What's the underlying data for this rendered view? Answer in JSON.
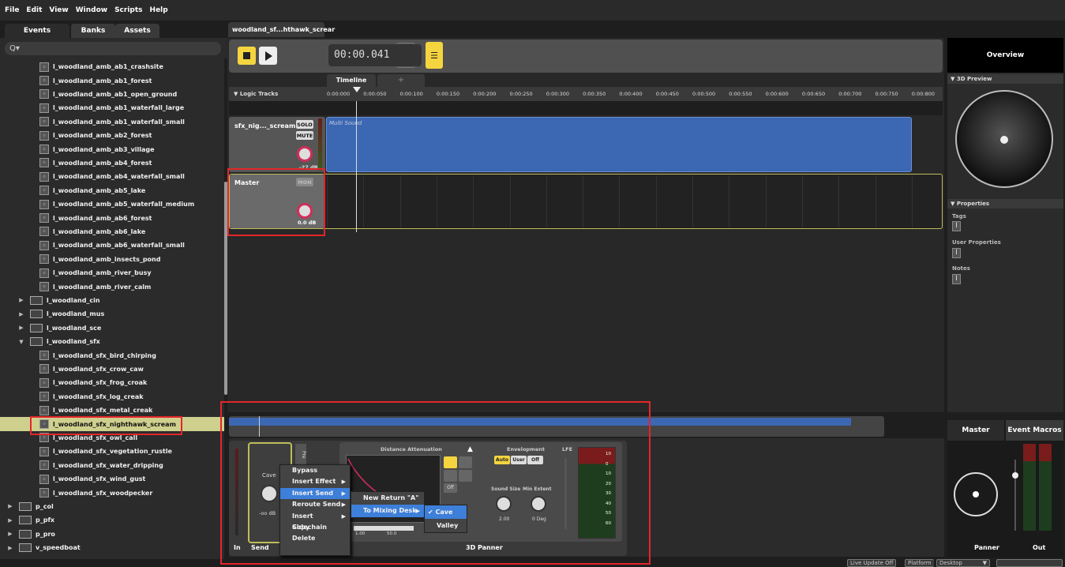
{
  "menu": [
    "File",
    "Edit",
    "View",
    "Window",
    "Scripts",
    "Help"
  ],
  "left_tabs": [
    "Events",
    "Banks",
    "Assets"
  ],
  "search": {
    "icon": "Q▾"
  },
  "browser_items": [
    {
      "type": "event",
      "label": "l_woodland_amb_ab1_crashsite",
      "indent": 1
    },
    {
      "type": "event",
      "label": "l_woodland_amb_ab1_forest",
      "indent": 1
    },
    {
      "type": "event",
      "label": "l_woodland_amb_ab1_open_ground",
      "indent": 1
    },
    {
      "type": "event",
      "label": "l_woodland_amb_ab1_waterfall_large",
      "indent": 1
    },
    {
      "type": "event",
      "label": "l_woodland_amb_ab1_waterfall_small",
      "indent": 1
    },
    {
      "type": "event",
      "label": "l_woodland_amb_ab2_forest",
      "indent": 1
    },
    {
      "type": "event",
      "label": "l_woodland_amb_ab3_village",
      "indent": 1
    },
    {
      "type": "event",
      "label": "l_woodland_amb_ab4_forest",
      "indent": 1
    },
    {
      "type": "event",
      "label": "l_woodland_amb_ab4_waterfall_small",
      "indent": 1
    },
    {
      "type": "event",
      "label": "l_woodland_amb_ab5_lake",
      "indent": 1
    },
    {
      "type": "event",
      "label": "l_woodland_amb_ab5_waterfall_medium",
      "indent": 1
    },
    {
      "type": "event",
      "label": "l_woodland_amb_ab6_forest",
      "indent": 1
    },
    {
      "type": "event",
      "label": "l_woodland_amb_ab6_lake",
      "indent": 1
    },
    {
      "type": "event",
      "label": "l_woodland_amb_ab6_waterfall_small",
      "indent": 1
    },
    {
      "type": "event",
      "label": "l_woodland_amb_insects_pond",
      "indent": 1
    },
    {
      "type": "event",
      "label": "l_woodland_amb_river_busy",
      "indent": 1
    },
    {
      "type": "event",
      "label": "l_woodland_amb_river_calm",
      "indent": 1
    },
    {
      "type": "folder",
      "label": "l_woodland_cin",
      "indent": 0,
      "open": false
    },
    {
      "type": "folder",
      "label": "l_woodland_mus",
      "indent": 0,
      "open": false
    },
    {
      "type": "folder",
      "label": "l_woodland_sce",
      "indent": 0,
      "open": false
    },
    {
      "type": "folder",
      "label": "l_woodland_sfx",
      "indent": 0,
      "open": true
    },
    {
      "type": "event",
      "label": "l_woodland_sfx_bird_chirping",
      "indent": 1
    },
    {
      "type": "event",
      "label": "l_woodland_sfx_crow_caw",
      "indent": 1
    },
    {
      "type": "event",
      "label": "l_woodland_sfx_frog_croak",
      "indent": 1
    },
    {
      "type": "event",
      "label": "l_woodland_sfx_log_creak",
      "indent": 1
    },
    {
      "type": "event",
      "label": "l_woodland_sfx_metal_creak",
      "indent": 1
    },
    {
      "type": "event",
      "label": "l_woodland_sfx_nighthawk_scream",
      "indent": 1,
      "selected": true
    },
    {
      "type": "event",
      "label": "l_woodland_sfx_owl_call",
      "indent": 1
    },
    {
      "type": "event",
      "label": "l_woodland_sfx_vegetation_rustle",
      "indent": 1
    },
    {
      "type": "event",
      "label": "l_woodland_sfx_water_dripping",
      "indent": 1
    },
    {
      "type": "event",
      "label": "l_woodland_sfx_wind_gust",
      "indent": 1
    },
    {
      "type": "event",
      "label": "l_woodland_sfx_woodpecker",
      "indent": 1
    },
    {
      "type": "folder",
      "label": "p_col",
      "indent": -1,
      "open": false
    },
    {
      "type": "folder",
      "label": "p_pfx",
      "indent": -1,
      "open": false
    },
    {
      "type": "folder",
      "label": "p_pro",
      "indent": -1,
      "open": false
    },
    {
      "type": "folder",
      "label": "v_speedboat",
      "indent": -1,
      "open": false
    }
  ],
  "editor": {
    "tab_title": "woodland_sf...hthawk_screar",
    "time": "00:00.041",
    "timeline_tab": "Timeline",
    "add_tab": "+",
    "logic_tracks": "▼ Logic Tracks",
    "ticks": [
      "0:00:000",
      "0:00:050",
      "0:00:100",
      "0:00:150",
      "0:00:200",
      "0:00:250",
      "0:00:300",
      "0:00:350",
      "0:00:400",
      "0:00:450",
      "0:00:500",
      "0:00:550",
      "0:00:600",
      "0:00:650",
      "0:00:700",
      "0:00:750",
      "0:00:800"
    ],
    "track1": {
      "name": "sfx_nig..._scream",
      "solo": "SOLO",
      "mute": "MUTE",
      "db": "-27 dB",
      "region": "Multi Sound"
    },
    "master": {
      "name": "Master",
      "mon": "MON",
      "db": "0.0 dB"
    }
  },
  "right": {
    "title": "Overview",
    "preview": "▼ 3D Preview",
    "properties": "▼ Properties",
    "tags": "Tags",
    "user_props": "User Properties",
    "notes": "Notes",
    "tab_master": "Master",
    "tab_macros": "Event Macros",
    "panner": "Panner",
    "out": "Out"
  },
  "deck": {
    "in": "In",
    "send": "Send",
    "cave": "Cave",
    "send_db": "-oo dB",
    "pre": "Pre",
    "dist_att": "Distance Attenuation",
    "off": "Off",
    "envelopment": "Envelopment",
    "lfe": "LFE",
    "auto": "Auto",
    "user": "User",
    "env_off": "Off",
    "sound_size": "Sound Size",
    "min_extent": "Min Extent",
    "ss_val": "2.00",
    "me_val": "0 Deg",
    "min": "1.00",
    "max": "50.0",
    "panner3d": "3D Panner",
    "meter": [
      "10",
      "0",
      "10",
      "20",
      "30",
      "40",
      "50",
      "60"
    ]
  },
  "context_menu": [
    "Bypass",
    "Insert Effect",
    "Insert Send",
    "Reroute Send",
    "Insert Sidechain",
    "Copy",
    "Delete"
  ],
  "submenu1": [
    "New Return \"A\"",
    "To Mixing Desk"
  ],
  "submenu2": [
    "✔ Cave",
    "Valley"
  ],
  "status": {
    "live": "Live Update Off",
    "platform": "Platform",
    "desktop": "Desktop"
  }
}
